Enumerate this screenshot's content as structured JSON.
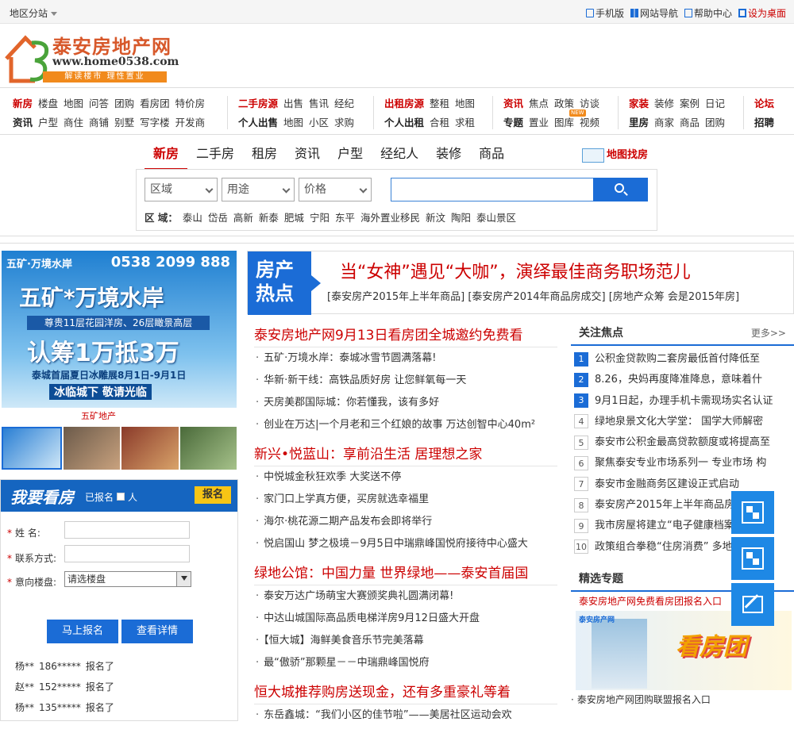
{
  "topbar": {
    "region": "地区分站",
    "links": [
      "手机版",
      "网站导航",
      "帮助中心",
      "设为桌面"
    ]
  },
  "logo": {
    "title": "泰安房地产网",
    "url": "www.home0538.com",
    "slogan": "解读楼市 理性置业"
  },
  "nav": {
    "g1": {
      "r1": [
        "新房",
        "楼盘",
        "地图",
        "问答",
        "团购",
        "看房团",
        "特价房"
      ],
      "r2": [
        "资讯",
        "户型",
        "商住",
        "商铺",
        "别墅",
        "写字楼",
        "开发商"
      ]
    },
    "g2": {
      "r1": [
        "二手房源",
        "出售",
        "售讯",
        "经纪"
      ],
      "r2": [
        "个人出售",
        "地图",
        "小区",
        "求购"
      ]
    },
    "g3": {
      "r1": [
        "出租房源",
        "整租",
        "地图"
      ],
      "r2": [
        "个人出租",
        "合租",
        "求租"
      ]
    },
    "g4": {
      "r1": [
        "资讯",
        "焦点",
        "政策",
        "访谈"
      ],
      "r2": [
        "专题",
        "置业",
        "图库",
        "视频"
      ],
      "badge": "NEW"
    },
    "g5": {
      "r1": [
        "家装",
        "装修",
        "案例",
        "日记"
      ],
      "r2": [
        "里房",
        "商家",
        "商品",
        "团购"
      ]
    },
    "g6": {
      "r1": [
        "论坛"
      ],
      "r2": [
        "招聘"
      ]
    }
  },
  "search": {
    "tabs": [
      "新房",
      "二手房",
      "租房",
      "资讯",
      "户型",
      "经纪人",
      "装修",
      "商品"
    ],
    "map_link": "地图找房",
    "selects": [
      "区域",
      "用途",
      "价格"
    ],
    "area_label": "区 域：",
    "areas": [
      "泰山",
      "岱岳",
      "高新",
      "新泰",
      "肥城",
      "宁阳",
      "东平",
      "海外置业移民",
      "新汶",
      "陶阳",
      "泰山景区"
    ]
  },
  "ad": {
    "brand": "五矿·万境水岸",
    "phone": "0538 2099 888",
    "name": "五矿*万境水岸",
    "tag": "尊贵11层花园洋房、26层瞰景高层",
    "big": "认筹1万抵3万",
    "line1": "泰城首届夏日冰雕展8月1日-9月1日",
    "line2": "冰临城下 敬请光临",
    "foot": "五矿地产"
  },
  "register": {
    "title": "我要看房",
    "count_prefix": "已报名",
    "count_suffix": "人",
    "badge": "报名",
    "fields": {
      "name": "姓    名:",
      "contact": "联系方式:",
      "building": "意向楼盘:"
    },
    "building_default": "请选楼盘",
    "btn_submit": "马上报名",
    "btn_detail": "查看详情",
    "signups": [
      {
        "name": "杨**",
        "phone": "186*****",
        "text": "报名了"
      },
      {
        "name": "赵**",
        "phone": "152*****",
        "text": "报名了"
      },
      {
        "name": "杨**",
        "phone": "135*****",
        "text": "报名了"
      }
    ]
  },
  "hot": {
    "label1": "房产",
    "label2": "热点",
    "title": "当“女神”遇见“大咖”，演绎最佳商务职场范儿",
    "sub": "[泰安房产2015年上半年商品] [泰安房产2014年商品房成交] [房地产众筹 会是2015年房]"
  },
  "news": [
    {
      "head": "泰安房地产网9月13日看房团全城邀约免费看",
      "items": [
        "五矿·万境水岸：泰城冰雪节圆满落幕!",
        "华新·新干线：高铁品质好房 让您鲜氧每一天",
        "天房美郡国际城：你若懂我，该有多好",
        "创业在万达|一个月老和三个红娘的故事 万达创智中心40m²"
      ]
    },
    {
      "head": "新兴•悦蓝山：享前沿生活 居理想之家",
      "items": [
        "中悦城金秋狂欢季 大奖送不停",
        "家门口上学真方便，买房就选幸福里",
        "海尔·桃花源二期产品发布会即将举行",
        "悦启国山 梦之极境－9月5日中瑞鼎峰国悦府接待中心盛大"
      ]
    },
    {
      "head": "绿地公馆：中国力量 世界绿地——泰安首届国",
      "items": [
        "泰安万达广场萌宝大赛颁奖典礼圆满闭幕!",
        "中达山城国际高品质电梯洋房9月12日盛大开盘",
        "【恒大城】海鲜美食音乐节完美落幕",
        "最“傲骄”那颗星－－中瑞鼎峰国悦府"
      ]
    },
    {
      "head": "恒大城推荐购房送现金，还有多重豪礼等着",
      "items": [
        "东岳鑫城：“我们小区的佳节啦”——美居社区运动会欢"
      ]
    }
  ],
  "focus": {
    "title": "关注焦点",
    "more": "更多>>",
    "items": [
      "公积金贷款购二套房最低首付降低至",
      "8.26，央妈再度降准降息，意味着什",
      "9月1日起，办理手机卡需现场实名认证",
      "绿地泉景文化大学堂： 国学大师解密",
      "泰安市公积金最高贷款额度或将提高至",
      "聚焦泰安专业市场系列一 专业市场 构",
      "泰安市金融商务区建设正式启动",
      "泰安房产2015年上半年商品房成交分",
      "我市房屋将建立“电子健康档案”",
      "政策组合拳稳“住房消费”  多地楼市"
    ]
  },
  "special": {
    "title": "精选专题",
    "link1": "泰安房地产网免费看房团报名入口",
    "img_title": "看房团",
    "img_brand": "泰安房产网",
    "link2": "泰安房地产网团购联盟报名入口"
  },
  "colors": {
    "accent": "#1b6cd6",
    "red": "#cc0000",
    "orange": "#f18a1c"
  }
}
